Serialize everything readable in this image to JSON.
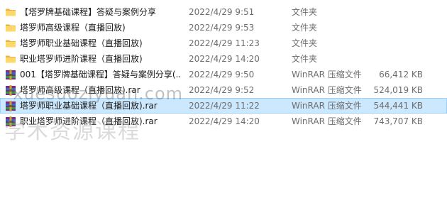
{
  "files": [
    {
      "icon": "folder-icon",
      "name": "【塔罗牌基础课程】答疑与案例分享",
      "date": "2022/4/29 9:51",
      "type": "文件夹",
      "size": ""
    },
    {
      "icon": "folder-icon",
      "name": "塔罗师高级课程（直播回放)",
      "date": "2022/4/29 9:53",
      "type": "文件夹",
      "size": ""
    },
    {
      "icon": "folder-icon",
      "name": "塔罗师职业基础课程（直播回放)",
      "date": "2022/4/29 11:23",
      "type": "文件夹",
      "size": ""
    },
    {
      "icon": "folder-icon",
      "name": "职业塔罗师进阶课程（直播回放)",
      "date": "2022/4/29 14:20",
      "type": "文件夹",
      "size": ""
    },
    {
      "icon": "winrar-archive-icon",
      "name": "001【塔罗牌基础课程】答疑与案例分享(...",
      "date": "2022/4/29 9:50",
      "type": "WinRAR 压缩文件",
      "size": "66,412 KB"
    },
    {
      "icon": "winrar-archive-icon",
      "name": "塔罗师高级课程（直播回放).rar",
      "date": "2022/4/29 9:52",
      "type": "WinRAR 压缩文件",
      "size": "524,019 KB"
    },
    {
      "icon": "winrar-archive-icon",
      "name": "塔罗师职业基础课程（直播回放).rar",
      "date": "2022/4/29 11:22",
      "type": "WinRAR 压缩文件",
      "size": "544,441 KB"
    },
    {
      "icon": "winrar-archive-icon",
      "name": "职业塔罗师进阶课程（直播回放).rar",
      "date": "2022/4/29 14:20",
      "type": "WinRAR 压缩文件",
      "size": "743,707 KB"
    }
  ],
  "selected_index": 6,
  "watermark": {
    "url": "xuesuoziyuan.com",
    "text": "学术资源课程"
  },
  "colors": {
    "selection_bg": "#cce8ff",
    "folder": "#ffd86b",
    "secondary_text": "#6d6d6d"
  }
}
